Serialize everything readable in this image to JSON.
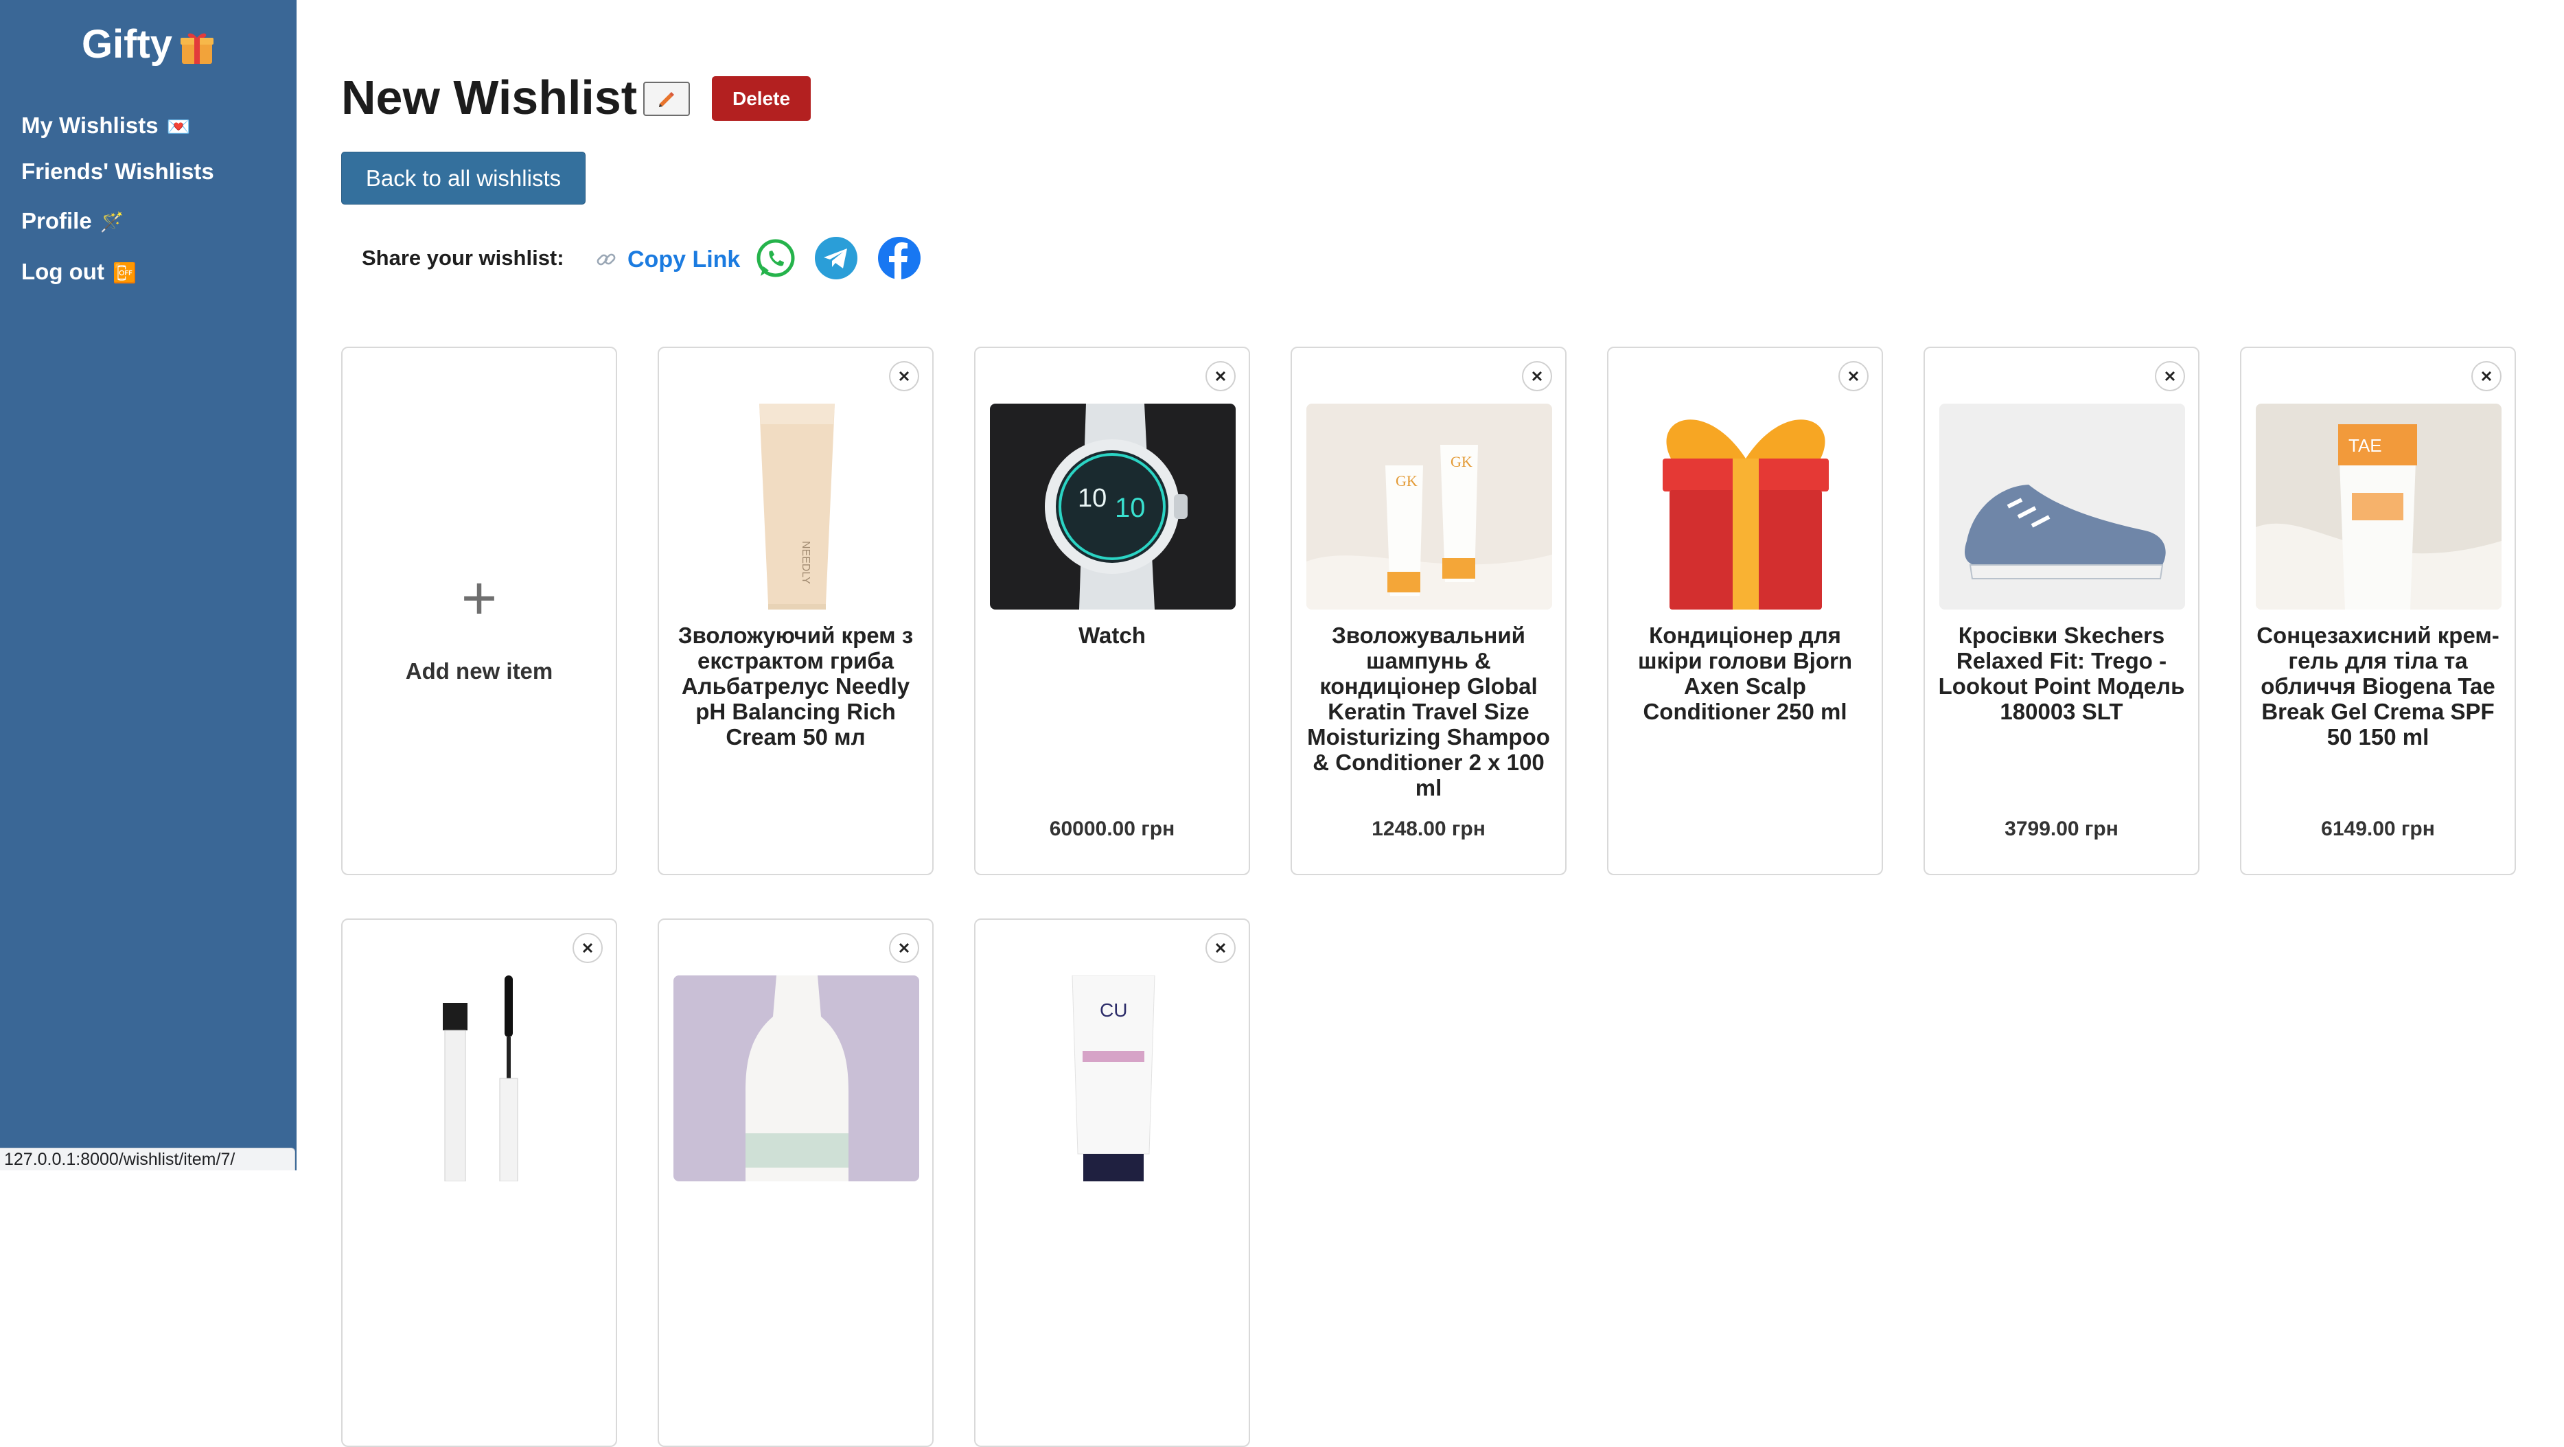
{
  "sidebar": {
    "brand": "Gifty",
    "items": [
      {
        "label": "My Wishlists",
        "emoji": "💌"
      },
      {
        "label": "Friends' Wishlists",
        "emoji": ""
      },
      {
        "label": "Profile",
        "emoji": "🪄"
      },
      {
        "label": "Log out",
        "emoji": "📴"
      }
    ]
  },
  "header": {
    "title": "New Wishlist",
    "delete_label": "Delete",
    "back_label": "Back to all wishlists"
  },
  "share": {
    "label": "Share your wishlist:",
    "copy_label": "Copy Link"
  },
  "items": [
    {
      "name": "Зволожуючий крем з екстрактом гриба Альбатрелус Needly pH Balancing Rich Cream 50 мл",
      "price": "",
      "image": "tube-cream-icon"
    },
    {
      "name": "Watch",
      "price": "60000.00 грн",
      "image": "smartwatch-icon"
    },
    {
      "name": "Зволожувальний шампунь & кондиціонер Global Keratin Travel Size Moisturizing Shampoo & Conditioner 2 x 100 ml",
      "price": "1248.00 грн",
      "image": "shampoo-pair-icon"
    },
    {
      "name": "Кондиціонер для шкіри голови Bjorn Axen Scalp Conditioner 250 ml",
      "price": "",
      "image": "gift-box-icon"
    },
    {
      "name": "Кросівки Skechers Relaxed Fit: Trego - Lookout Point Модель 180003 SLT",
      "price": "3799.00 грн",
      "image": "sneaker-icon"
    },
    {
      "name": "Сонцезахисний крем-гель для тіла та обличчя Biogena Tae Break Gel Crema SPF 50 150 ml",
      "price": "6149.00 грн",
      "image": "sunscreen-tube-icon"
    },
    {
      "name": "",
      "price": "",
      "image": "mascara-icon"
    },
    {
      "name": "",
      "price": "",
      "image": "bottle-icon"
    },
    {
      "name": "",
      "price": "",
      "image": "cleanser-tube-icon"
    }
  ],
  "add_item": {
    "plus": "+",
    "label": "Add new item"
  },
  "statusbar": {
    "url": "127.0.0.1:8000/wishlist/item/7/"
  }
}
